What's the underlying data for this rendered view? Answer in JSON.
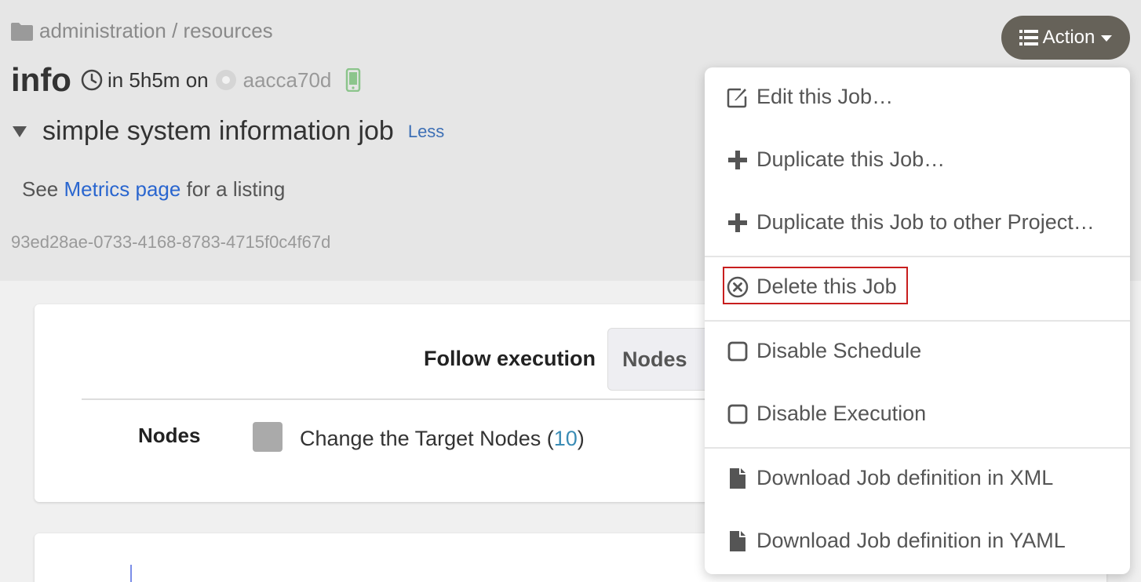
{
  "breadcrumb": {
    "text": "administration / resources"
  },
  "job": {
    "name": "info",
    "schedule": "in 5h5m on",
    "node": "aacca70d",
    "description_title": "simple system information job",
    "less_link": "Less",
    "see_prefix": "See",
    "see_link": "Metrics page",
    "see_suffix": "for a listing",
    "uuid": "93ed28ae-0733-4168-8783-4715f0c4f67d"
  },
  "action_button": {
    "label": "Action"
  },
  "execution": {
    "follow_label": "Follow execution",
    "nodes_tab": "Nodes",
    "nodes_label": "Nodes",
    "change_target_prefix": "Change the Target Nodes (",
    "change_target_count": "10",
    "change_target_suffix": ")"
  },
  "menu": {
    "items": [
      {
        "label": "Edit this Job…",
        "icon": "edit-icon"
      },
      {
        "label": "Duplicate this Job…",
        "icon": "plus-icon"
      },
      {
        "label": "Duplicate this Job to other Project…",
        "icon": "plus-icon"
      },
      {
        "label": "Delete this Job",
        "icon": "delete-circle-icon"
      },
      {
        "label": "Disable Schedule",
        "icon": "checkbox-icon"
      },
      {
        "label": "Disable Execution",
        "icon": "checkbox-icon"
      },
      {
        "label": "Download Job definition in XML",
        "icon": "file-icon"
      },
      {
        "label": "Download Job definition in YAML",
        "icon": "file-icon"
      }
    ]
  },
  "colors": {
    "header_bg": "#e6e6e6",
    "action_button_bg": "#666259",
    "link": "#2a66cf",
    "highlight_border": "#c81e1e",
    "node_count": "#3a8cb5"
  }
}
